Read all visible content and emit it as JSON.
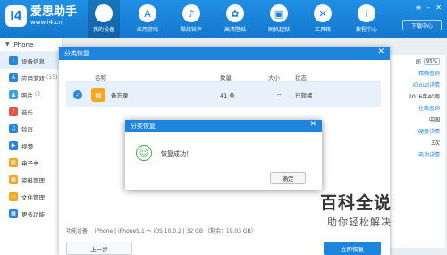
{
  "app": {
    "logo_badge": "i4",
    "brand": "爱思助手",
    "site": "www.i4.cn",
    "download_center": "下载中心",
    "colors": {
      "primary": "#1d85dc",
      "success": "#3cb44a"
    }
  },
  "nav": [
    {
      "label": "我的设备",
      "icon": "apple-icon",
      "glyph": ""
    },
    {
      "label": "应用游戏",
      "icon": "app-store-icon",
      "glyph": "A"
    },
    {
      "label": "酷炫铃声",
      "icon": "bell-icon",
      "glyph": "♪"
    },
    {
      "label": "高清壁纸",
      "icon": "wallpaper-icon",
      "glyph": "✿"
    },
    {
      "label": "刷机越狱",
      "icon": "box-icon",
      "glyph": "▣"
    },
    {
      "label": "工具箱",
      "icon": "toolbox-icon",
      "glyph": "✕"
    },
    {
      "label": "教程中心",
      "icon": "info-icon",
      "glyph": "i"
    }
  ],
  "sidebar": {
    "device": "iPhone",
    "items": [
      {
        "label": "设备信息",
        "count": "",
        "icon": "device-info-icon",
        "color": "#2a86d8",
        "glyph": "i"
      },
      {
        "label": "应用游戏",
        "count": "(15)",
        "icon": "apps-icon",
        "color": "#2a86d8",
        "glyph": "A"
      },
      {
        "label": "照片",
        "count": "(2",
        "icon": "photo-icon",
        "color": "#3aa3e3",
        "glyph": "▲"
      },
      {
        "label": "音乐",
        "count": "",
        "icon": "music-icon",
        "color": "#e2554b",
        "glyph": "♪"
      },
      {
        "label": "铃声",
        "count": "",
        "icon": "ringtone-icon",
        "color": "#2a86d8",
        "glyph": "♫"
      },
      {
        "label": "视频",
        "count": "",
        "icon": "video-icon",
        "color": "#2a86d8",
        "glyph": "▶"
      },
      {
        "label": "电子书",
        "count": "",
        "icon": "ebook-icon",
        "color": "#f5a623",
        "glyph": "▤"
      },
      {
        "label": "资料管理",
        "count": "",
        "icon": "data-icon",
        "color": "#f5a623",
        "glyph": "▦"
      },
      {
        "label": "文件管理",
        "count": "",
        "icon": "folder-icon",
        "color": "#f5a623",
        "glyph": "▭"
      },
      {
        "label": "更多功能",
        "count": "",
        "icon": "more-icon",
        "color": "#2a86d8",
        "glyph": "▦"
      }
    ]
  },
  "info_col": [
    {
      "text": "间",
      "pct": "95%"
    },
    {
      "text": "精确查询"
    },
    {
      "text": "iCloud详情"
    },
    {
      "text": "2016年40周"
    },
    {
      "text": "在线查询"
    },
    {
      "text": "中国"
    },
    {
      "text": "硬盘详情"
    },
    {
      "text": "3次"
    },
    {
      "text": "电池详情"
    }
  ],
  "dialog": {
    "title": "分类恢复",
    "columns": {
      "name": "名称",
      "count": "数量",
      "size": "大小",
      "status": "状态"
    },
    "row": {
      "name": "备忘录",
      "count": "41 条",
      "size": "--",
      "status": "已就绪"
    },
    "device_info": "功能设备： iPhone  |  iPhone9,1 ～ iOS 10.0.2  |  32 GB （剩余：19.03 GB）",
    "prev_button": "上一步",
    "restore_button": "立即恢复"
  },
  "modal": {
    "title": "分类恢复",
    "message": "恢复成功！",
    "ok_button": "确定"
  },
  "watermark": {
    "main": "百科全说",
    "sub": "助你轻松解决"
  }
}
